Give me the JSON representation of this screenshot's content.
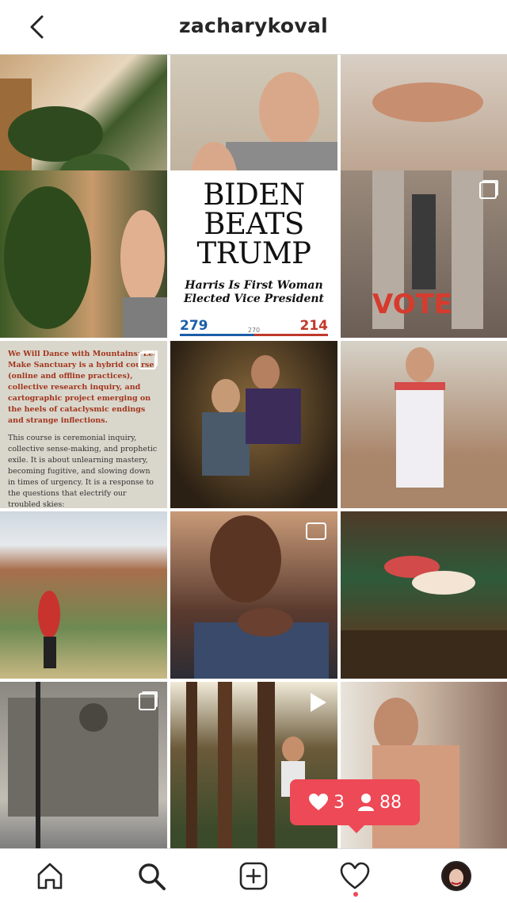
{
  "header": {
    "title": "zacharykoval",
    "back_icon": "chevron-left-icon"
  },
  "posts": {
    "news": {
      "headline_lines": [
        "BIDEN",
        "BEATS",
        "TRUMP"
      ],
      "subhead": "Harris Is First Woman Elected Vice President",
      "biden_votes": "279",
      "total_label": "270",
      "trump_votes": "214"
    },
    "course": {
      "title": "We Will Dance with Mountains: Let Make Sanctuary is a hybrid course (online and offline practices), collective research inquiry, and cartographic project emerging on the heels of cataclysmic endings and strange inflections.",
      "body": "This course is ceremonial inquiry, collective sense-making, and prophetic exile. It is about unlearning mastery, becoming fugitive, and slowing down in times of urgency. It is a response to the questions that electrify our troubled skies:"
    },
    "vote_sign": "VOTE"
  },
  "notification": {
    "likes": "3",
    "followers": "88"
  },
  "tabbar": {
    "icons": [
      "home-icon",
      "search-icon",
      "add-post-icon",
      "heart-icon",
      "profile-avatar"
    ]
  },
  "colors": {
    "accent": "#ed4956"
  }
}
